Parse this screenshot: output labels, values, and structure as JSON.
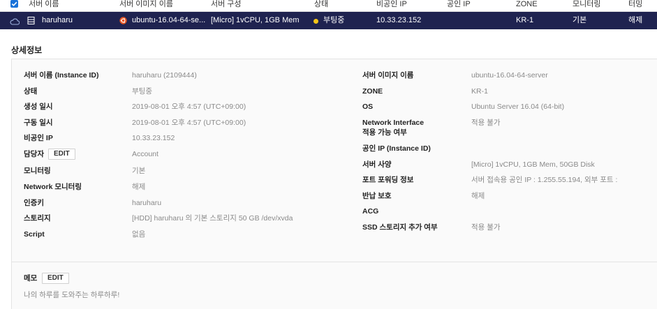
{
  "table": {
    "headers": [
      "서버 이름",
      "서버 이미지 이름",
      "서버 구성",
      "상태",
      "비공인 IP",
      "공인 IP",
      "ZONE",
      "모니터링",
      "터밍"
    ],
    "selected_row": {
      "name": "haruharu",
      "image": "ubuntu-16.04-64-se...",
      "spec": "[Micro] 1vCPU, 1GB Mem",
      "status": "부팅중",
      "private_ip": "10.33.23.152",
      "public_ip": "",
      "zone": "KR-1",
      "monitoring": "기본",
      "termination": "해제"
    }
  },
  "details": {
    "title": "상세정보",
    "edit_label": "EDIT",
    "left": [
      {
        "label": "서버 이름 (Instance ID)",
        "value": "haruharu (2109444)"
      },
      {
        "label": "상태",
        "value": "부팅중"
      },
      {
        "label": "생성 일시",
        "value": "2019-08-01 오후 4:57 (UTC+09:00)"
      },
      {
        "label": "구동 일시",
        "value": "2019-08-01 오후 4:57 (UTC+09:00)"
      },
      {
        "label": "비공인 IP",
        "value": "10.33.23.152"
      },
      {
        "label": "담당자",
        "value": "Account"
      },
      {
        "label": "모니터링",
        "value": "기본"
      },
      {
        "label": "Network 모니터링",
        "value": "해제"
      },
      {
        "label": "인증키",
        "value": "haruharu"
      },
      {
        "label": "스토리지",
        "value": "[HDD] haruharu 의 기본 스토리지  50 GB /dev/xvda"
      },
      {
        "label": "Script",
        "value": "없음"
      }
    ],
    "right": [
      {
        "label": "서버 이미지 이름",
        "value": "ubuntu-16.04-64-server"
      },
      {
        "label": "ZONE",
        "value": "KR-1"
      },
      {
        "label": "OS",
        "value": "Ubuntu Server 16.04 (64-bit)"
      },
      {
        "label": "Network Interface",
        "label2": "적용 가능 여부",
        "value": "적용 불가"
      },
      {
        "label": "공인 IP (Instance ID)",
        "value": ""
      },
      {
        "label": "서버 사양",
        "value": "[Micro] 1vCPU, 1GB Mem, 50GB Disk"
      },
      {
        "label": "포트 포워딩 정보",
        "value": "서버 접속용 공인 IP : 1.255.55.194, 외부 포트 :"
      },
      {
        "label": "반납 보호",
        "value": "해제"
      },
      {
        "label": "ACG",
        "value": ""
      },
      {
        "label": "SSD 스토리지 추가 여부",
        "value": "적용 불가"
      }
    ]
  },
  "memo": {
    "label": "메모",
    "edit_label": "EDIT",
    "text": "나의 하루를 도와주는 하루하루!"
  },
  "colors": {
    "selected_row_bg": "#1f2350",
    "status_booting": "#f5c518",
    "checkbox": "#1a73d9",
    "ubuntu_icon": "#e95420"
  }
}
